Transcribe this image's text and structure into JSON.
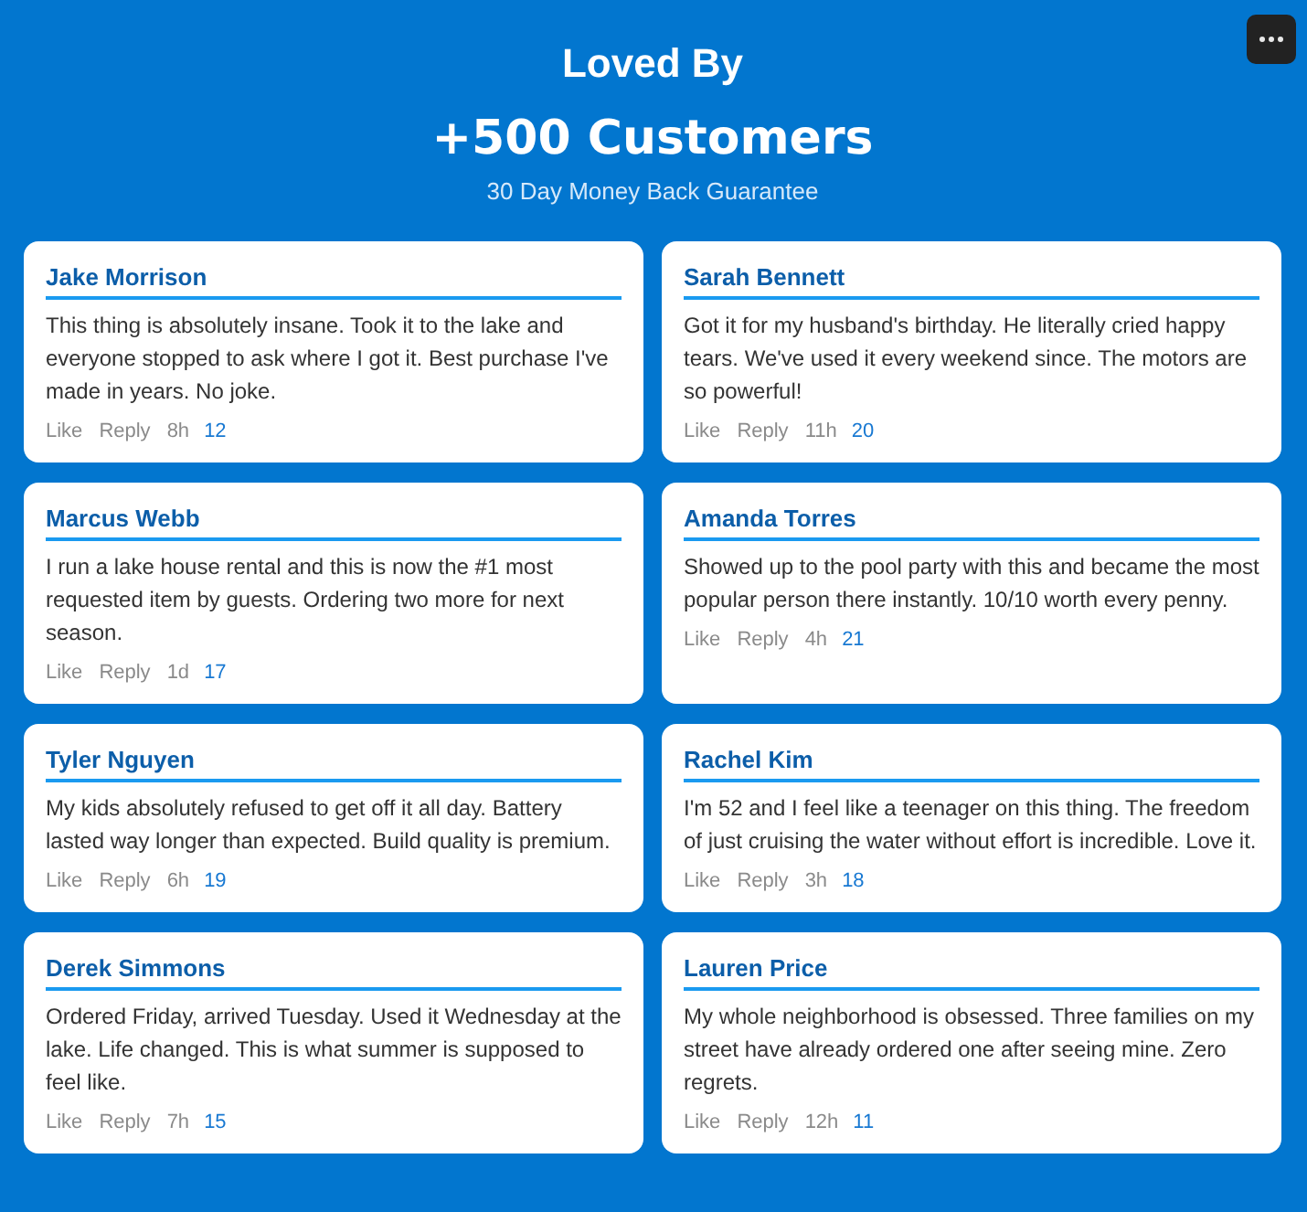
{
  "header": {
    "title": "Loved By",
    "headline": "+500 Customers",
    "subtitle": "30 Day Money Back Guarantee"
  },
  "reviews": [
    {
      "name": "Jake Morrison",
      "text": "This thing is absolutely insane. Took it to the lake and everyone stopped to ask where I got it. Best purchase I've made in years. No joke.",
      "actions": [
        "Like",
        "Reply"
      ],
      "time": "8h",
      "count": "12"
    },
    {
      "name": "Sarah Bennett",
      "text": "Got it for my husband's birthday. He literally cried happy tears. We've used it every weekend since. The motors are so powerful!",
      "actions": [
        "Like",
        "Reply"
      ],
      "time": "11h",
      "count": "20"
    },
    {
      "name": "Marcus Webb",
      "text": "I run a lake house rental and this is now the #1 most requested item by guests. Ordering two more for next season.",
      "actions": [
        "Like",
        "Reply"
      ],
      "time": "1d",
      "count": "17"
    },
    {
      "name": "Amanda Torres",
      "text": "Showed up to the pool party with this and became the most popular person there instantly. 10/10 worth every penny.",
      "actions": [
        "Like",
        "Reply"
      ],
      "time": "4h",
      "count": "21"
    },
    {
      "name": "Tyler Nguyen",
      "text": "My kids absolutely refused to get off it all day. Battery lasted way longer than expected. Build quality is premium.",
      "actions": [
        "Like",
        "Reply"
      ],
      "time": "6h",
      "count": "19"
    },
    {
      "name": "Rachel Kim",
      "text": "I'm 52 and I feel like a teenager on this thing. The freedom of just cruising the water without effort is incredible. Love it.",
      "actions": [
        "Like",
        "Reply"
      ],
      "time": "3h",
      "count": "18"
    },
    {
      "name": "Derek Simmons",
      "text": "Ordered Friday, arrived Tuesday. Used it Wednesday at the lake. Life changed. This is what summer is supposed to feel like.",
      "actions": [
        "Like",
        "Reply"
      ],
      "time": "7h",
      "count": "15"
    },
    {
      "name": "Lauren Price",
      "text": "My whole neighborhood is obsessed. Three families on my street have already ordered one after seeing mine. Zero regrets.",
      "actions": [
        "Like",
        "Reply"
      ],
      "time": "12h",
      "count": "11"
    }
  ]
}
